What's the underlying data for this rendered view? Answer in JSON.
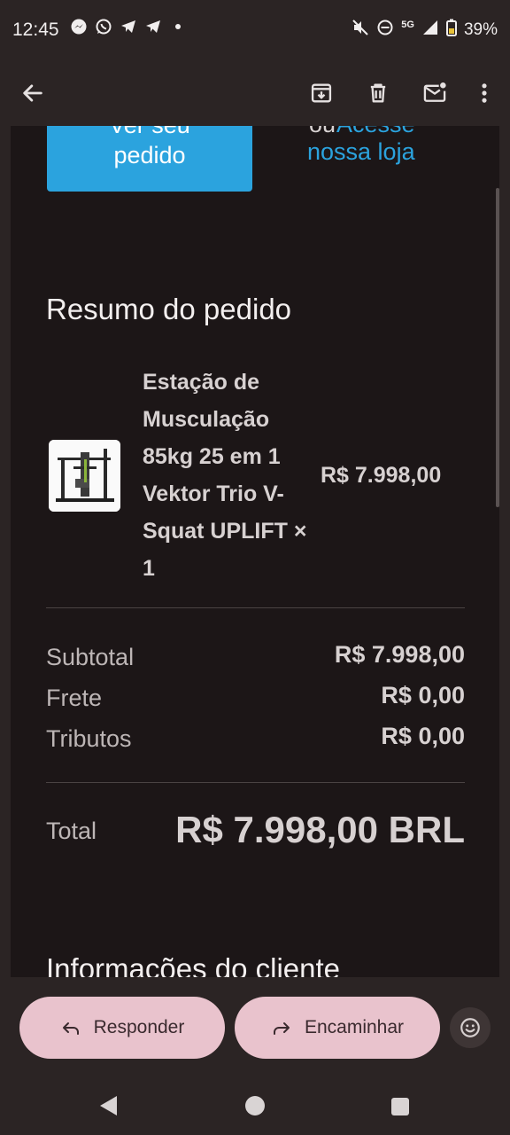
{
  "status_bar": {
    "time": "12:45",
    "network": "5G",
    "battery": "39%",
    "left_icons": [
      "messenger-icon",
      "whatsapp-icon",
      "telegram-icon",
      "telegram-icon",
      "dot-icon"
    ],
    "right_icons": [
      "mute-icon",
      "dnd-icon",
      "signal-icon",
      "battery-icon"
    ]
  },
  "toolbar": {
    "icons": [
      "back-arrow-icon",
      "archive-icon",
      "delete-icon",
      "mark-unread-icon",
      "more-vert-icon"
    ]
  },
  "email": {
    "cta_button": {
      "line1": "Ver seu",
      "line2": "pedido"
    },
    "or_text": "ou",
    "store_link": {
      "line1": "Acesse",
      "line2": "nossa loja"
    },
    "summary_title": "Resumo do pedido",
    "product": {
      "name": "Estação de Musculação 85kg 25 em 1 Vektor Trio V-Squat UPLIFT × 1",
      "price": "R$ 7.998,00"
    },
    "rows": [
      {
        "label": "Subtotal",
        "value": "R$ 7.998,00"
      },
      {
        "label": "Frete",
        "value": "R$ 0,00"
      },
      {
        "label": "Tributos",
        "value": "R$ 0,00"
      }
    ],
    "total": {
      "label": "Total",
      "value": "R$ 7.998,00 BRL"
    },
    "next_section_title": "Informações do cliente"
  },
  "actions": {
    "reply_label": "Responder",
    "forward_label": "Encaminhar"
  },
  "colors": {
    "accent_blue": "#2ba3de",
    "pill_pink": "#e9c3cd",
    "background": "#1c1617",
    "chrome": "#2b2424"
  }
}
